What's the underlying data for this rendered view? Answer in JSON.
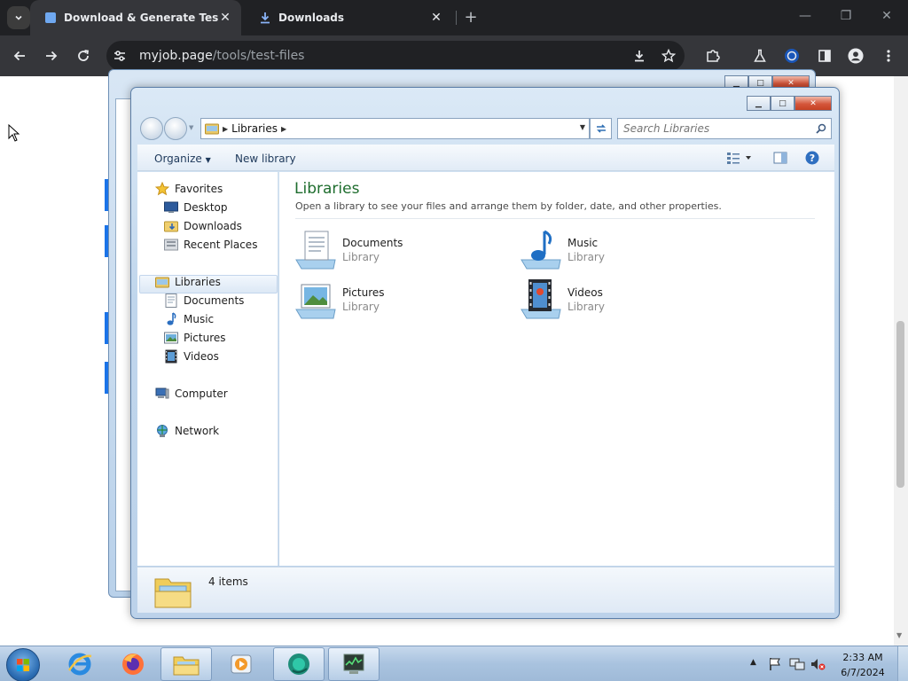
{
  "browser": {
    "tabs": [
      {
        "title": "Download & Generate Test Files",
        "active": true,
        "icon": "page-favicon"
      },
      {
        "title": "Downloads",
        "active": false,
        "icon": "download-icon"
      }
    ],
    "tab_close_glyph": "✕",
    "new_tab_glyph": "+",
    "window_controls": {
      "minimize": "—",
      "restore": "❐",
      "close": "✕"
    },
    "url": {
      "host": "myjob.page",
      "path": "/tools/test-files"
    }
  },
  "explorer": {
    "breadcrumb": "Libraries",
    "search_placeholder": "Search Libraries",
    "toolbar": {
      "organize": "Organize",
      "new_library": "New library"
    },
    "nav": {
      "favorites": {
        "label": "Favorites",
        "items": [
          "Desktop",
          "Downloads",
          "Recent Places"
        ]
      },
      "libraries": {
        "label": "Libraries",
        "items": [
          "Documents",
          "Music",
          "Pictures",
          "Videos"
        ]
      },
      "computer": "Computer",
      "network": "Network"
    },
    "content": {
      "title": "Libraries",
      "subtitle": "Open a library to see your files and arrange them by folder, date, and other properties.",
      "items": [
        {
          "name": "Documents",
          "kind": "Library",
          "icon": "documents-library-icon"
        },
        {
          "name": "Music",
          "kind": "Library",
          "icon": "music-library-icon"
        },
        {
          "name": "Pictures",
          "kind": "Library",
          "icon": "pictures-library-icon"
        },
        {
          "name": "Videos",
          "kind": "Library",
          "icon": "videos-library-icon"
        }
      ]
    },
    "details": {
      "count": "4 items"
    }
  },
  "taskbar": {
    "apps": [
      "internet-explorer",
      "firefox",
      "windows-explorer",
      "media-player",
      "browser",
      "task-manager"
    ],
    "clock": {
      "time": "2:33 AM",
      "date": "6/7/2024"
    }
  },
  "colors": {
    "chrome_dark": "#202124",
    "chrome_tab": "#35363a",
    "library_title": "#1e6d2e",
    "aero_frame": "#c0d6ec"
  }
}
